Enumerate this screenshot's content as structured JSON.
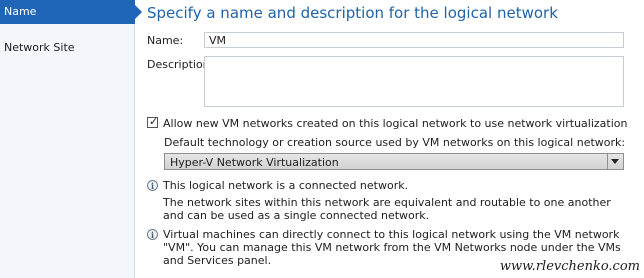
{
  "sidebar": {
    "items": [
      {
        "label": "Name",
        "active": true
      },
      {
        "label": "Network Site",
        "active": false
      }
    ]
  },
  "main": {
    "title": "Specify a name and description for the logical network",
    "name_label": "Name:",
    "name_value": "VM",
    "description_label": "Description:",
    "description_value": "",
    "allow_virtualization": {
      "checked": true,
      "label": "Allow new VM networks created on this logical network to use network virtualization"
    },
    "default_technology_label": "Default technology or creation source used by VM networks on this logical network:",
    "technology_select": {
      "value": "Hyper-V Network Virtualization"
    },
    "info": [
      {
        "text": "This logical network is a connected network."
      },
      {
        "text": "The network sites within this network are equivalent and routable to one another and can be used as a single connected network."
      },
      {
        "text": "Virtual machines can directly connect to this logical network using the VM network \"VM\". You can manage this VM network from the VM Networks node under the VMs and Services panel."
      }
    ]
  },
  "watermark": "www.rlevchenko.com",
  "colors": {
    "accent": "#1f66b8",
    "title": "#1f63a8"
  },
  "icons": {
    "info": "info-icon",
    "dropdown": "chevron-down-icon",
    "check": "checkmark-icon"
  }
}
